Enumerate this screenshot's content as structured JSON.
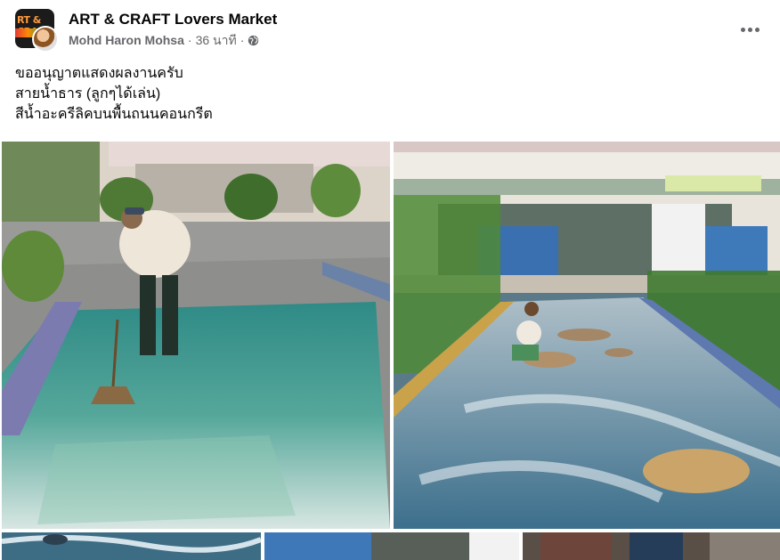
{
  "post": {
    "group_name": "ART & CRAFT Lovers Market",
    "author": "Mohd Haron Mohsa",
    "separator": "·",
    "time": "36 นาที",
    "separator2": "·",
    "audience_icon": "globe-icon",
    "more_icon": "more-horizontal-icon",
    "group_avatar_text": "RT & CRA",
    "caption_lines": [
      "ขออนุญาตแสดงผลงานครับ",
      "สายน้ำธาร (ลูกๆได้เล่น)",
      "สีน้ำอะครีลิคบนพื้นถนนคอนกรีต"
    ]
  },
  "colors": {
    "text_primary": "#050505",
    "text_secondary": "#65676b",
    "background": "#ffffff"
  }
}
